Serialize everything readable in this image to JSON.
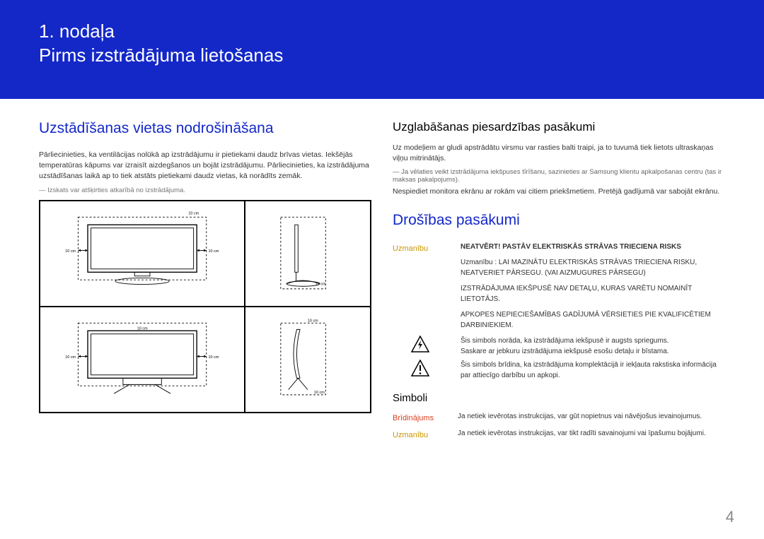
{
  "header": {
    "chapter": "1. nodaļa",
    "title": "Pirms izstrādājuma lietošanas"
  },
  "left": {
    "heading": "Uzstādīšanas vietas nodrošināšana",
    "para": "Pārliecinieties, ka ventilācijas nolūkā ap izstrādājumu ir pietiekami daudz brīvas vietas. Iekšējās temperatūras kāpums var izraisīt aizdegšanos un bojāt izstrādājumu. Pārliecinieties, ka izstrādājuma uzstādīšanas laikā ap to tiek atstāts pietiekami daudz vietas, kā norādīts zemāk.",
    "note": "Izskats var atšķirties atkarībā no izstrādājuma.",
    "clearance": {
      "top": "10 cm",
      "left": "10 cm",
      "right": "10 cm",
      "bottom": "10 cm"
    }
  },
  "right": {
    "storage_heading": "Uzglabāšanas piesardzības pasākumi",
    "storage_para": "Uz modeļiem ar gludi apstrādātu virsmu var rasties balti traipi, ja to tuvumā tiek lietots ultraskaņas viļņu mitrinātājs.",
    "storage_note": "Ja vēlaties veikt izstrādājuma iekšpuses tīrīšanu, sazinieties ar Samsung klientu apkalpošanas centru (tas ir maksas pakalpojums).",
    "storage_warn": "Nespiediet monitora ekrānu ar rokām vai citiem priekšmetiem. Pretējā gadījumā var sabojāt ekrānu.",
    "safety_heading": "Drošības pasākumi",
    "caution_label": "Uzmanību",
    "caution_lines": [
      "NEATVĒRT! PASTĀV ELEKTRISKĀS STRĀVAS TRIECIENA RISKS",
      "Uzmanību : LAI MAZINĀTU ELEKTRISKĀS STRĀVAS TRIECIENA RISKU, NEATVERIET PĀRSEGU. (VAI AIZMUGURES PĀRSEGU)",
      "IZSTRĀDĀJUMA IEKŠPUSĒ NAV DETAĻU, KURAS VARĒTU NOMAINĪT LIETOTĀJS.",
      "APKOPES NEPIECIEŠAMĪBAS GADĪJUMĀ VĒRSIETIES PIE KVALIFICĒTIEM DARBINIEKIEM."
    ],
    "bolt_text": "Šis simbols norāda, ka izstrādājuma iekšpusē ir augsts spriegums.",
    "bolt_text2": "Saskare ar jebkuru izstrādājuma iekšpusē esošu detaļu ir bīstama.",
    "excl_text": "Šis simbols brīdina, ka izstrādājuma komplektācijā ir iekļauta rakstiska informācija par attiecīgo darbību un apkopi.",
    "simboli_heading": "Simboli",
    "warning_label": "Brīdinājums",
    "warning_text": "Ja netiek ievērotas instrukcijas, var gūt nopietnus vai nāvējošus ievainojumus.",
    "caution_label2": "Uzmanību",
    "caution_text2": "Ja netiek ievērotas instrukcijas, var tikt radīti savainojumi vai īpašumu bojājumi."
  },
  "page_number": "4"
}
